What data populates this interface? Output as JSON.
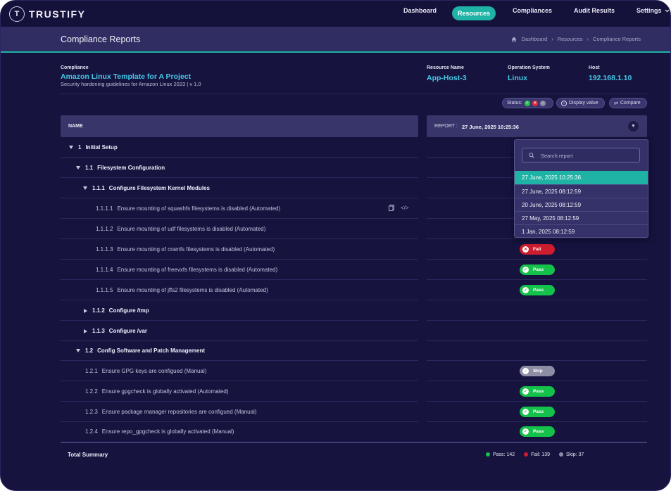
{
  "app": {
    "logo_text": "TRUSTIFY",
    "logo_mark": "T"
  },
  "nav": {
    "items": [
      "Dashboard",
      "Resources",
      "Compliances",
      "Audit Results",
      "Settings"
    ],
    "active": "Resources"
  },
  "page": {
    "title": "Compliance Reports",
    "breadcrumb": [
      "Dashboard",
      "Compliance Reports"
    ],
    "breadcrumb_middle": "Resources"
  },
  "info": {
    "compliance_label": "Compliance",
    "compliance_name": "Amazon Linux Template for A Project",
    "compliance_desc": "Security hardening guidelines for Amazon Linux 2023 | v 1.0",
    "resource_label": "Resource Name",
    "resource_value": "App-Host-3",
    "os_label": "Operation System",
    "os_value": "Linux",
    "host_label": "Host",
    "host_value": "192.168.1.10"
  },
  "toolbar": {
    "status_label": "Status:",
    "display_value_label": "Display value",
    "compare_label": "Compare"
  },
  "table": {
    "name_header": "NAME",
    "report_label": "REPORT :",
    "report_date": "27 June, 2025  10:25:36"
  },
  "rows": [
    {
      "num": "1",
      "title": "Initial Setup"
    },
    {
      "num": "1.1",
      "title": "Filesystem Configuration"
    },
    {
      "num": "1.1.1",
      "title": "Configure Filesystem Kernel Modules"
    },
    {
      "num": "1.1.1.1",
      "title": "Ensure mounting of squashfs filesystems is disabled (Automated)"
    },
    {
      "num": "1.1.1.2",
      "title": "Ensure mounting of udf filesystems is disabled (Automated)"
    },
    {
      "num": "1.1.1.3",
      "title": "Ensure mounting of cramfs filesystems is disabled (Automated)",
      "status": "Fail"
    },
    {
      "num": "1.1.1.4",
      "title": "Ensure mounting of freevxfs filesystems is disabled (Automated)",
      "status": "Pass"
    },
    {
      "num": "1.1.1.5",
      "title": "Ensure mounting of jffs2 filesystems is disabled (Automated)",
      "status": "Pass"
    },
    {
      "num": "1.1.2",
      "title": "Configure /tmp"
    },
    {
      "num": "1.1.3",
      "title": "Configure /var"
    },
    {
      "num": "1.2",
      "title": "Config Software and Patch Management"
    },
    {
      "num": "1.2.1",
      "title": "Ensure GPG keys are configued (Manual)",
      "status": "Skip"
    },
    {
      "num": "1.2.2",
      "title": "Ensure gpgcheck is globally activated (Automated)",
      "status": "Pass"
    },
    {
      "num": "1.2.3",
      "title": "Ensure package manager repositories are configued (Manual)",
      "status": "Pass"
    },
    {
      "num": "1.2.4",
      "title": "Ensure repo_gpgcheck is globally activated (Manual)",
      "status": "Pass"
    }
  ],
  "dropdown": {
    "search_placeholder": "Search report",
    "options": [
      "27 June, 2025  10:25:36",
      "27 June, 2025  08:12:59",
      "20 June, 2025  08:12:59",
      "27 May, 2025  08:12:59",
      "1 Jan, 2025  08:12:59"
    ],
    "selected_index": 0
  },
  "summary": {
    "title": "Total Summary",
    "pass": "Pass: 142",
    "fail": "Fail: 139",
    "skip": "Skip: 37"
  },
  "colors": {
    "accent": "#1fb3a6",
    "pass": "#14c14a",
    "fail": "#cf1d30",
    "skip": "#8d8da6",
    "link": "#46c8e6"
  }
}
